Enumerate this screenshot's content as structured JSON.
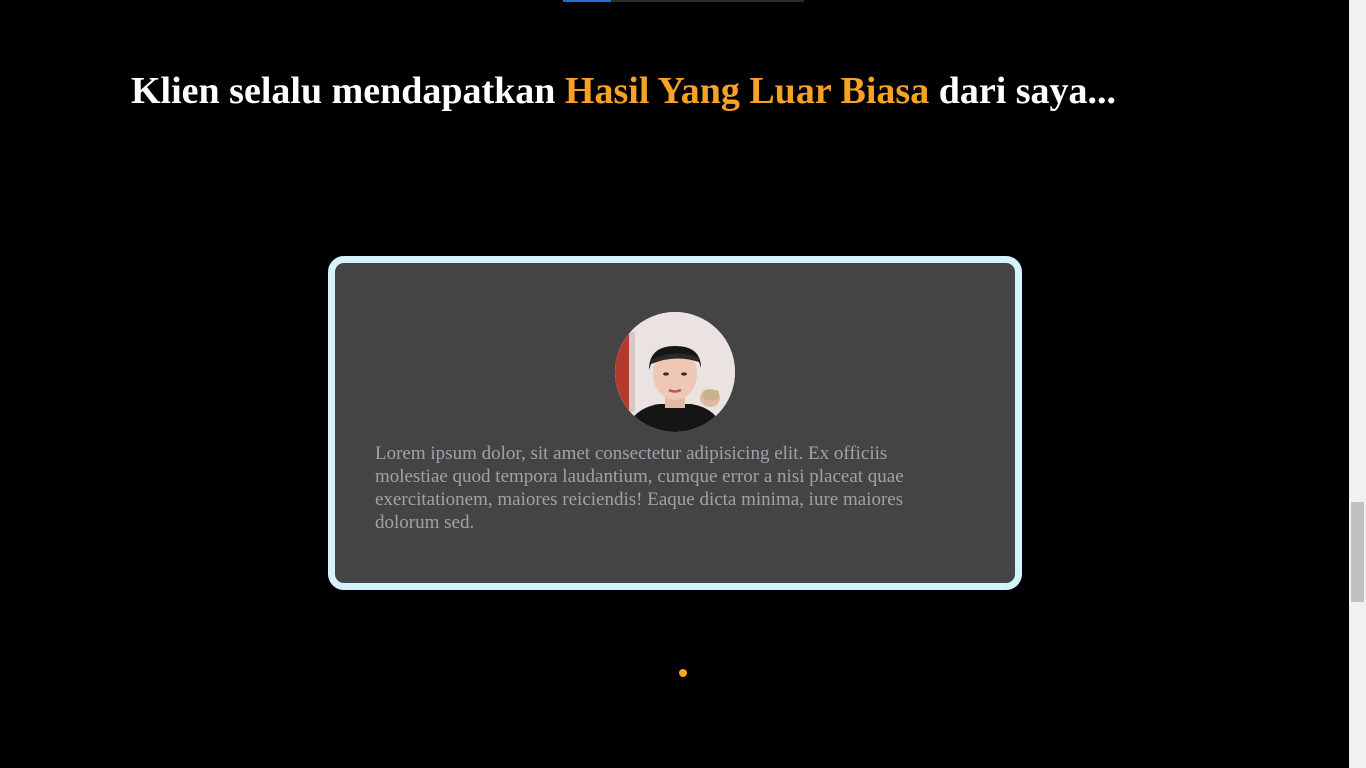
{
  "page": {
    "progress_fraction": 0.2
  },
  "headline": {
    "prefix": "Klien selalu mendapatkan ",
    "highlight": "Hasil Yang Luar Biasa",
    "suffix": " dari saya...",
    "accent_color": "#f7a227"
  },
  "testimonial": {
    "avatar_icon": "client-avatar-photo",
    "text": "Lorem ipsum dolor, sit amet consectetur adipisicing elit. Ex officiis molestiae quod tempora laudantium, cumque error a nisi placeat quae exercitationem, maiores reiciendis! Eaque dicta minima, iure maiores dolorum sed.",
    "border_color": "#d6f2fb",
    "background_color": "#444444"
  },
  "carousel": {
    "slide_count": 1,
    "active_index": 0
  }
}
